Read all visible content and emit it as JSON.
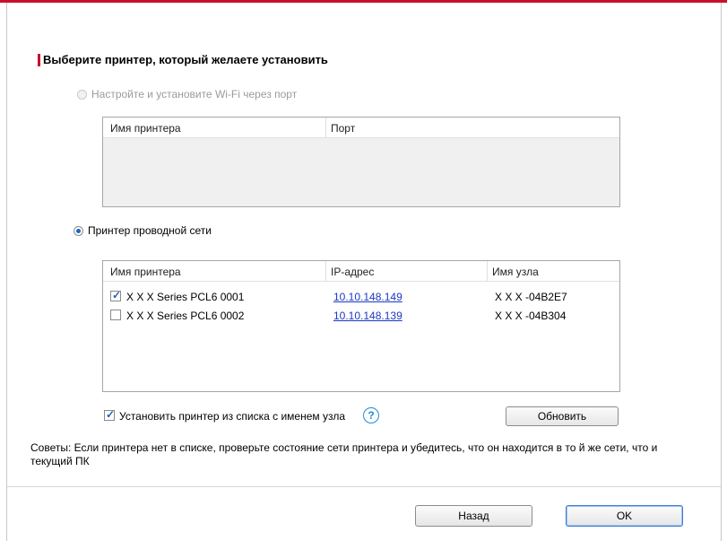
{
  "heading": "Выберите принтер, который желаете установить",
  "wifi": {
    "label": "Настройте и установите Wi-Fi через порт",
    "columns": [
      "Имя принтера",
      "Порт"
    ]
  },
  "wired": {
    "label": "Принтер проводной сети",
    "columns": [
      "Имя принтера",
      "IP-адрес",
      "Имя узла"
    ],
    "rows": [
      {
        "name": "X X X  Series PCL6 0001",
        "ip": "10.10.148.149",
        "host": "X X X -04B2E7",
        "checked": true
      },
      {
        "name": "X X X  Series PCL6 0002",
        "ip": "10.10.148.139",
        "host": "X X X -04B304",
        "checked": false
      }
    ]
  },
  "install_by_hostname": {
    "label": "Установить принтер из списка с именем узла",
    "checked": true
  },
  "help_glyph": "?",
  "refresh_label": "Обновить",
  "tips": "Советы: Если принтера нет в списке, проверьте состояние сети принтера и убедитесь, что он находится в то й же сети, что и текущий ПК",
  "buttons": {
    "back": "Назад",
    "ok": "OK"
  },
  "colors": {
    "accent": "#c8102e",
    "link": "#1a38c6",
    "help": "#1f8cde"
  }
}
